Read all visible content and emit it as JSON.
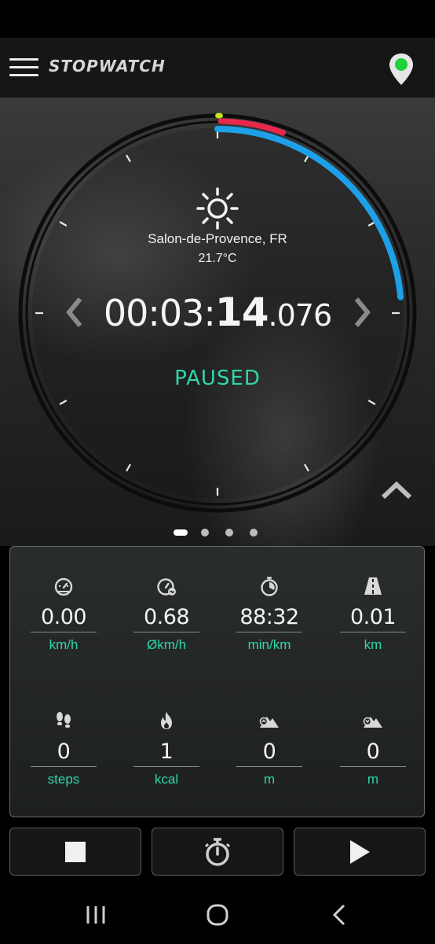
{
  "app": {
    "title": "STOPWATCH",
    "gps_status_color": "#1fd13a"
  },
  "weather": {
    "icon": "sun-icon",
    "location": "Salon-de-Provence, FR",
    "temperature": "21.7°C"
  },
  "timer": {
    "hours_minutes": "00:03:",
    "seconds": "14",
    "milliseconds": ".076",
    "status": "PAUSED",
    "progress_arc_color": "#1ea0e8",
    "accent_arc_color": "#e8284a",
    "marker_color": "#c8e61e"
  },
  "pager": {
    "pages": 4,
    "active_index": 0
  },
  "stats": [
    {
      "icon": "speedometer-icon",
      "value": "0.00",
      "unit": "km/h"
    },
    {
      "icon": "average-speed-icon",
      "value": "0.68",
      "unit": "Økm/h"
    },
    {
      "icon": "stopwatch-icon",
      "value": "88:32",
      "unit": "min/km"
    },
    {
      "icon": "road-icon",
      "value": "0.01",
      "unit": "km"
    },
    {
      "icon": "footsteps-icon",
      "value": "0",
      "unit": "steps"
    },
    {
      "icon": "flame-icon",
      "value": "1",
      "unit": "kcal"
    },
    {
      "icon": "elevation-up-icon",
      "value": "0",
      "unit": "m"
    },
    {
      "icon": "elevation-down-icon",
      "value": "0",
      "unit": "m"
    }
  ],
  "controls": {
    "stop": "stop-icon",
    "lap": "stopwatch-icon",
    "play": "play-icon"
  },
  "colors": {
    "accent_green": "#2fd7a8",
    "app_bar": "#161616"
  }
}
